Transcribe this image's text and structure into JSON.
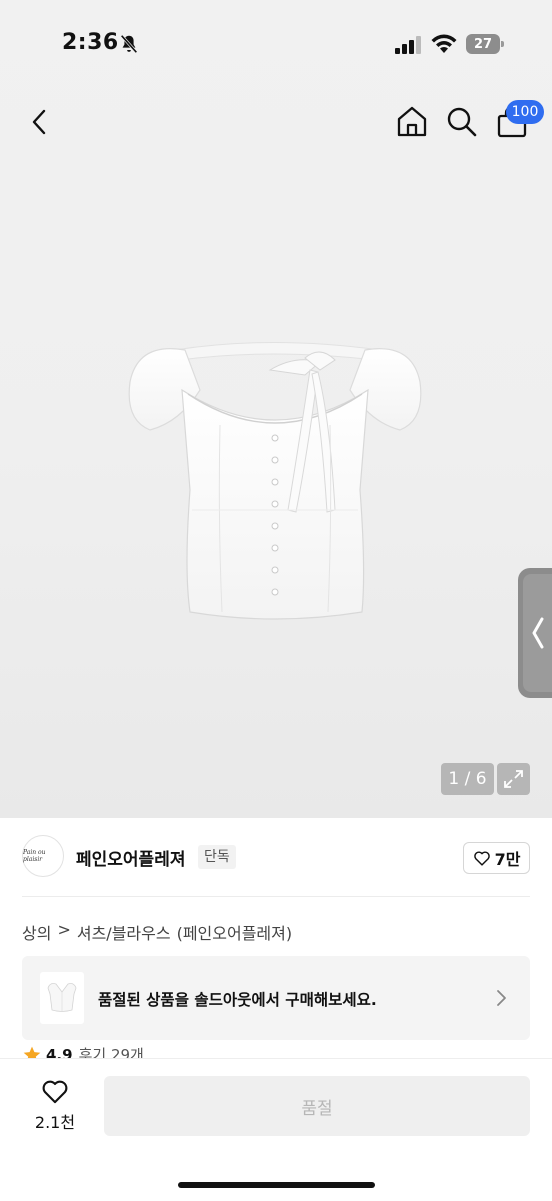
{
  "status_bar": {
    "time": "2:36",
    "battery": "27"
  },
  "nav": {
    "cart_badge": "100"
  },
  "gallery": {
    "counter": "1 / 6"
  },
  "brand": {
    "logo_text": "Pain ou plaisir",
    "name": "페인오어플레져",
    "tag": "단독",
    "likes": "7만"
  },
  "breadcrumb": {
    "category": "상의",
    "separator": ">",
    "subcategory": "셔츠/블라우스",
    "brand": "(페인오어플레져)"
  },
  "soldout_banner": {
    "text": "품절된 상품을 솔드아웃에서 구매해보세요."
  },
  "rating": {
    "value": "4.9",
    "reviews": "후기 29개"
  },
  "bottom_bar": {
    "wish_count": "2.1천",
    "purchase_label": "품절"
  },
  "colors": {
    "accent": "#2f6df0",
    "star": "#f5a623"
  }
}
